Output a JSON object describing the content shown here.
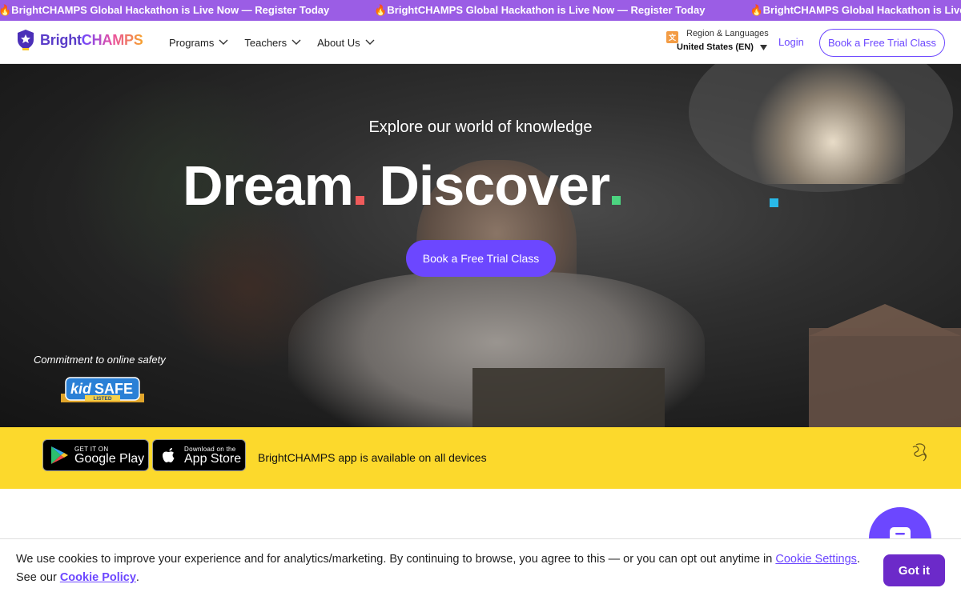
{
  "ticker": {
    "items": [
      "🔥BrightCHAMPS Global Hackathon is Live Now — Register Today",
      "🔥BrightCHAMPS Global Hackathon is Live Now — Register Today",
      "🔥BrightCHAMPS Global Hackathon is Live Now — Register Today"
    ]
  },
  "header": {
    "logo_bright": "Bright",
    "logo_champs": "CHAMPS",
    "menu": [
      {
        "label": "Programs",
        "icon": "chevron-down-icon"
      },
      {
        "label": "Teachers",
        "icon": "chevron-down-icon"
      },
      {
        "label": "About Us",
        "icon": "chevron-down-icon"
      }
    ],
    "region_label": "Region & Languages",
    "region_value": "United States (EN)",
    "login_label": "Login",
    "cta_label": "Book a Free Trial Class"
  },
  "hero": {
    "subtitle": "Explore our world of knowledge",
    "word1": "Dream",
    "word2": "Discover",
    "cta_label": "Book a Free Trial Class",
    "safety_text": "Commitment to online safety",
    "kidsafe_logo": {
      "kid": "kid",
      "safe": "SAFE",
      "listed": "LISTED"
    }
  },
  "app_bar": {
    "google_play_small": "GET IT ON",
    "google_play_big": "Google Play",
    "app_store_small": "Download on the",
    "app_store_big": "App Store",
    "text": "BrightCHAMPS app is available on all devices"
  },
  "cookie": {
    "text_before": "We use cookies to improve your experience and for analytics/marketing. By continuing to browse, you agree to this — or you can opt out anytime in ",
    "settings_link": "Cookie Settings",
    "text_middle": ". See our ",
    "policy_link": "Cookie Policy",
    "text_after": ".",
    "button_label": "Got it"
  },
  "colors": {
    "brand_purple": "#6c47ff",
    "ticker_bg": "#9b5de5",
    "app_bar_bg": "#fcd92c",
    "dot_red": "#ef5b5b",
    "dot_green": "#4cd480",
    "dot_cyan": "#29b9e8"
  }
}
